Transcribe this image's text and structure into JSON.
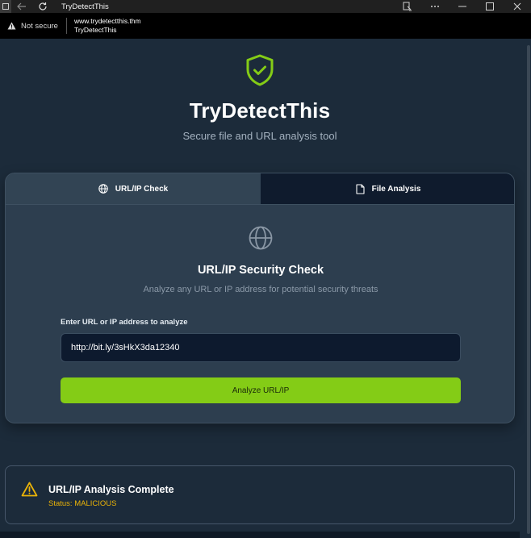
{
  "window": {
    "title": "TryDetectThis"
  },
  "address_bar": {
    "security_label": "Not secure",
    "url": "www.trydetectthis.thm",
    "page_title": "TryDetectThis"
  },
  "hero": {
    "title": "TryDetectThis",
    "subtitle": "Secure file and URL analysis tool",
    "logo_icon": "shield-check-icon",
    "accent_color": "#84cc16"
  },
  "tabs": [
    {
      "label": "URL/IP Check",
      "icon": "globe-icon",
      "active": true
    },
    {
      "label": "File Analysis",
      "icon": "file-icon",
      "active": false
    }
  ],
  "url_check": {
    "icon": "globe-icon",
    "title": "URL/IP Security Check",
    "description": "Analyze any URL or IP address for potential security threats",
    "input_label": "Enter URL or IP address to analyze",
    "input_value": "http://bit.ly/3sHkX3da12340",
    "button_label": "Analyze URL/IP",
    "button_color": "#84cc16"
  },
  "result": {
    "icon": "warning-icon",
    "title": "URL/IP Analysis Complete",
    "status": "Status: MALICIOUS",
    "status_color": "#eab308"
  }
}
